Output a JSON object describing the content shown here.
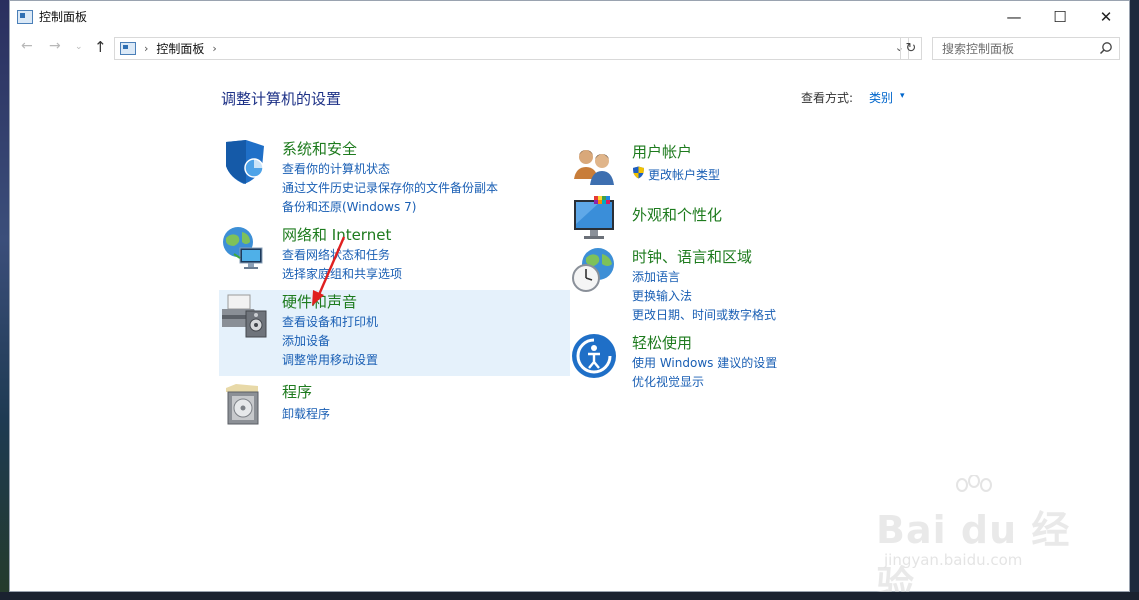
{
  "window": {
    "title": "控制面板",
    "controls": {
      "minimize": "—",
      "maximize": "☐",
      "close": "✕"
    }
  },
  "nav": {
    "back": "←",
    "forward": "→",
    "recent": "⌄",
    "up": "↑",
    "breadcrumb": "控制面板",
    "separator": "›",
    "refresh": "↻",
    "dropdown": "⌄"
  },
  "search": {
    "placeholder": "搜索控制面板"
  },
  "page": {
    "heading": "调整计算机的设置",
    "view_by_label": "查看方式:",
    "view_by_value": "类别",
    "view_by_arrow": "▾"
  },
  "categories": {
    "system_security": {
      "title": "系统和安全",
      "links": [
        "查看你的计算机状态",
        "通过文件历史记录保存你的文件备份副本",
        "备份和还原(Windows 7)"
      ]
    },
    "network": {
      "title": "网络和 Internet",
      "links": [
        "查看网络状态和任务",
        "选择家庭组和共享选项"
      ]
    },
    "hardware_sound": {
      "title": "硬件和声音",
      "links": [
        "查看设备和打印机",
        "添加设备",
        "调整常用移动设置"
      ]
    },
    "programs": {
      "title": "程序",
      "links": [
        "卸载程序"
      ]
    },
    "user_accounts": {
      "title": "用户帐户",
      "links": [
        "更改帐户类型"
      ]
    },
    "appearance": {
      "title": "外观和个性化",
      "links": []
    },
    "clock_region": {
      "title": "时钟、语言和区域",
      "links": [
        "添加语言",
        "更换输入法",
        "更改日期、时间或数字格式"
      ]
    },
    "ease_of_access": {
      "title": "轻松使用",
      "links": [
        "使用 Windows 建议的设置",
        "优化视觉显示"
      ]
    }
  },
  "watermark": {
    "brand": "Bai du 经验",
    "url": "jingyan.baidu.com"
  },
  "colors": {
    "category_title": "#1e7b1e",
    "link": "#1a5fb4",
    "heading": "#1e3287",
    "hover": "#e5f1fb",
    "arrow": "#e02020"
  }
}
